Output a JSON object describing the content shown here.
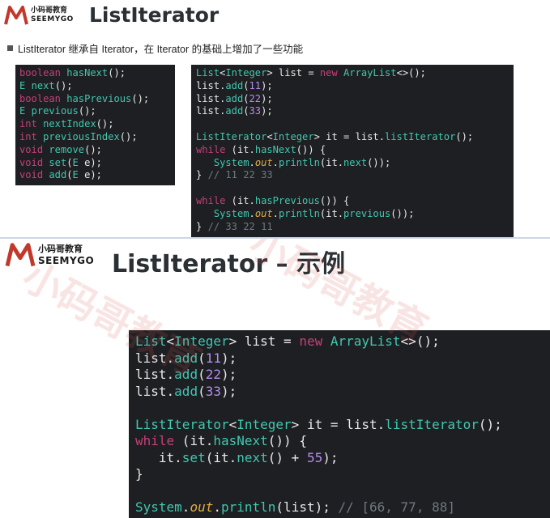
{
  "brand": {
    "name_cn": "小码哥教育",
    "name_en": "SEEMYGO",
    "logo_color": "#c0392b"
  },
  "slide1": {
    "title": "ListIterator",
    "bullet": "ListIterator 继承自 Iterator，在 Iterator 的基础上增加了一些功能",
    "methods": [
      [
        [
          "kw",
          "boolean"
        ],
        [
          "pl",
          " "
        ],
        [
          "fn",
          "hasNext"
        ],
        [
          "pl",
          "();"
        ]
      ],
      [
        [
          "ty",
          "E"
        ],
        [
          "pl",
          " "
        ],
        [
          "fn",
          "next"
        ],
        [
          "pl",
          "();"
        ]
      ],
      [
        [
          "kw",
          "boolean"
        ],
        [
          "pl",
          " "
        ],
        [
          "fn",
          "hasPrevious"
        ],
        [
          "pl",
          "();"
        ]
      ],
      [
        [
          "ty",
          "E"
        ],
        [
          "pl",
          " "
        ],
        [
          "fn",
          "previous"
        ],
        [
          "pl",
          "();"
        ]
      ],
      [
        [
          "kw",
          "int"
        ],
        [
          "pl",
          " "
        ],
        [
          "fn",
          "nextIndex"
        ],
        [
          "pl",
          "();"
        ]
      ],
      [
        [
          "kw",
          "int"
        ],
        [
          "pl",
          " "
        ],
        [
          "fn",
          "previousIndex"
        ],
        [
          "pl",
          "();"
        ]
      ],
      [
        [
          "kw",
          "void"
        ],
        [
          "pl",
          " "
        ],
        [
          "fn",
          "remove"
        ],
        [
          "pl",
          "();"
        ]
      ],
      [
        [
          "kw",
          "void"
        ],
        [
          "pl",
          " "
        ],
        [
          "fn",
          "set"
        ],
        [
          "pl",
          "("
        ],
        [
          "ty",
          "E"
        ],
        [
          "pl",
          " e);"
        ]
      ],
      [
        [
          "kw",
          "void"
        ],
        [
          "pl",
          " "
        ],
        [
          "fn",
          "add"
        ],
        [
          "pl",
          "("
        ],
        [
          "ty",
          "E"
        ],
        [
          "pl",
          " e);"
        ]
      ]
    ],
    "example": [
      [
        [
          "ty",
          "List"
        ],
        [
          "pl",
          "<"
        ],
        [
          "ty",
          "Integer"
        ],
        [
          "pl",
          "> list = "
        ],
        [
          "kw",
          "new"
        ],
        [
          "pl",
          " "
        ],
        [
          "ty",
          "ArrayList"
        ],
        [
          "pl",
          "<>();"
        ]
      ],
      [
        [
          "pl",
          "list."
        ],
        [
          "fn",
          "add"
        ],
        [
          "pl",
          "("
        ],
        [
          "num",
          "11"
        ],
        [
          "pl",
          ");"
        ]
      ],
      [
        [
          "pl",
          "list."
        ],
        [
          "fn",
          "add"
        ],
        [
          "pl",
          "("
        ],
        [
          "num",
          "22"
        ],
        [
          "pl",
          ");"
        ]
      ],
      [
        [
          "pl",
          "list."
        ],
        [
          "fn",
          "add"
        ],
        [
          "pl",
          "("
        ],
        [
          "num",
          "33"
        ],
        [
          "pl",
          ");"
        ]
      ],
      [],
      [
        [
          "ty",
          "ListIterator"
        ],
        [
          "pl",
          "<"
        ],
        [
          "ty",
          "Integer"
        ],
        [
          "pl",
          "> it = list."
        ],
        [
          "fn",
          "listIterator"
        ],
        [
          "pl",
          "();"
        ]
      ],
      [
        [
          "kw",
          "while"
        ],
        [
          "pl",
          " (it."
        ],
        [
          "fn",
          "hasNext"
        ],
        [
          "pl",
          "()) {"
        ]
      ],
      [
        [
          "pl",
          "   "
        ],
        [
          "ty",
          "System"
        ],
        [
          "pl",
          "."
        ],
        [
          "it",
          "out"
        ],
        [
          "pl",
          "."
        ],
        [
          "fn",
          "println"
        ],
        [
          "pl",
          "(it."
        ],
        [
          "fn",
          "next"
        ],
        [
          "pl",
          "());"
        ]
      ],
      [
        [
          "pl",
          "} "
        ],
        [
          "cm",
          "// 11 22 33"
        ]
      ],
      [],
      [
        [
          "kw",
          "while"
        ],
        [
          "pl",
          " (it."
        ],
        [
          "fn",
          "hasPrevious"
        ],
        [
          "pl",
          "()) {"
        ]
      ],
      [
        [
          "pl",
          "   "
        ],
        [
          "ty",
          "System"
        ],
        [
          "pl",
          "."
        ],
        [
          "it",
          "out"
        ],
        [
          "pl",
          "."
        ],
        [
          "fn",
          "println"
        ],
        [
          "pl",
          "(it."
        ],
        [
          "fn",
          "previous"
        ],
        [
          "pl",
          "());"
        ]
      ],
      [
        [
          "pl",
          "} "
        ],
        [
          "cm",
          "// 33 22 11"
        ]
      ]
    ]
  },
  "slide2": {
    "title": "ListIterator – 示例",
    "example": [
      [
        [
          "ty",
          "List"
        ],
        [
          "pl",
          "<"
        ],
        [
          "ty",
          "Integer"
        ],
        [
          "pl",
          "> list = "
        ],
        [
          "kw",
          "new"
        ],
        [
          "pl",
          " "
        ],
        [
          "ty",
          "ArrayList"
        ],
        [
          "pl",
          "<>();"
        ]
      ],
      [
        [
          "pl",
          "list."
        ],
        [
          "fn",
          "add"
        ],
        [
          "pl",
          "("
        ],
        [
          "num",
          "11"
        ],
        [
          "pl",
          ");"
        ]
      ],
      [
        [
          "pl",
          "list."
        ],
        [
          "fn",
          "add"
        ],
        [
          "pl",
          "("
        ],
        [
          "num",
          "22"
        ],
        [
          "pl",
          ");"
        ]
      ],
      [
        [
          "pl",
          "list."
        ],
        [
          "fn",
          "add"
        ],
        [
          "pl",
          "("
        ],
        [
          "num",
          "33"
        ],
        [
          "pl",
          ");"
        ]
      ],
      [],
      [
        [
          "ty",
          "ListIterator"
        ],
        [
          "pl",
          "<"
        ],
        [
          "ty",
          "Integer"
        ],
        [
          "pl",
          "> it = list."
        ],
        [
          "fn",
          "listIterator"
        ],
        [
          "pl",
          "();"
        ]
      ],
      [
        [
          "kw",
          "while"
        ],
        [
          "pl",
          " (it."
        ],
        [
          "fn",
          "hasNext"
        ],
        [
          "pl",
          "()) {"
        ]
      ],
      [
        [
          "pl",
          "   it."
        ],
        [
          "fn",
          "set"
        ],
        [
          "pl",
          "(it."
        ],
        [
          "fn",
          "next"
        ],
        [
          "pl",
          "() + "
        ],
        [
          "num",
          "55"
        ],
        [
          "pl",
          ");"
        ]
      ],
      [
        [
          "pl",
          "}"
        ]
      ],
      [],
      [
        [
          "ty",
          "System"
        ],
        [
          "pl",
          "."
        ],
        [
          "it",
          "out"
        ],
        [
          "pl",
          "."
        ],
        [
          "fn",
          "println"
        ],
        [
          "pl",
          "(list); "
        ],
        [
          "cm",
          "// [66, 77, 88]"
        ]
      ]
    ]
  },
  "watermark": "小码哥教育"
}
